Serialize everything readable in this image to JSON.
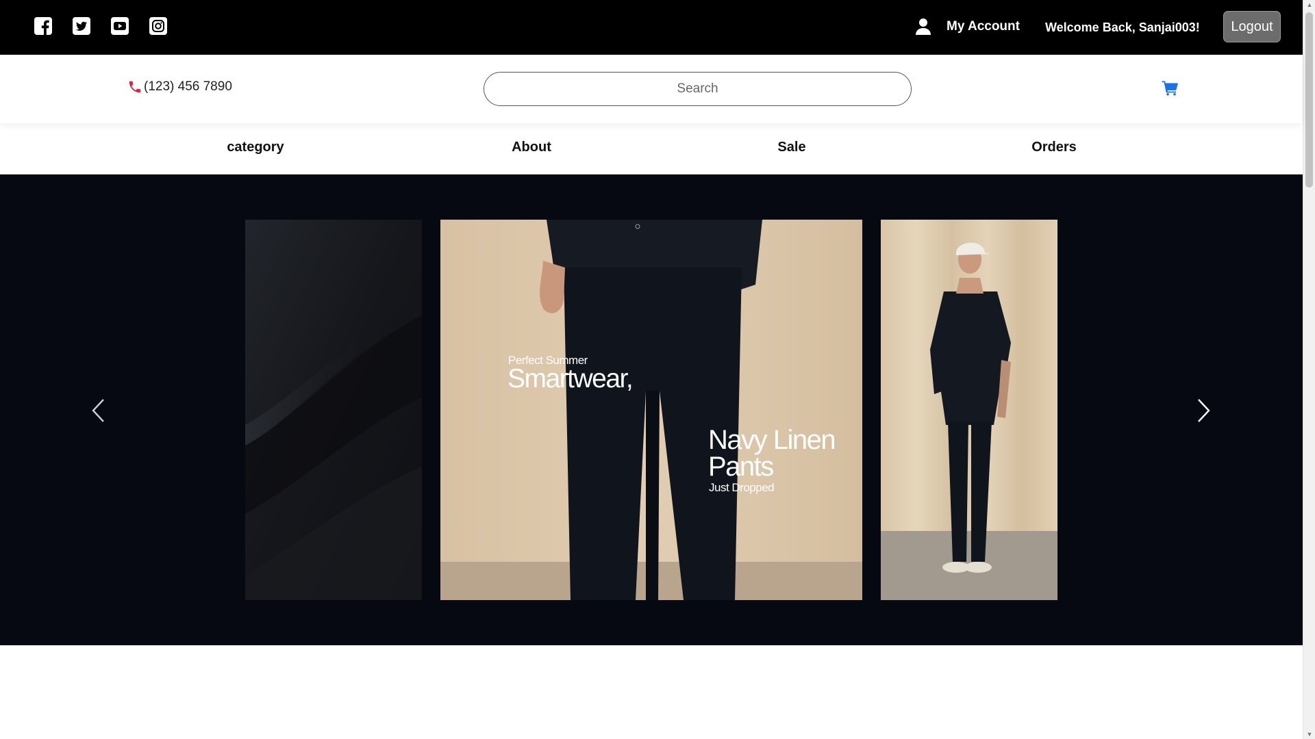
{
  "topbar": {
    "social": [
      {
        "icon": "facebook-icon"
      },
      {
        "icon": "twitter-icon"
      },
      {
        "icon": "youtube-icon"
      },
      {
        "icon": "instagram-icon"
      }
    ],
    "account_label": "My Account",
    "welcome_text": "Welcome Back, Sanjai003!",
    "logout_label": "Logout"
  },
  "header": {
    "phone": "(123) 456 7890",
    "search_placeholder": "Search",
    "search_value": "",
    "cart_icon": "cart-icon"
  },
  "nav": {
    "items": [
      {
        "label": "category"
      },
      {
        "label": "About"
      },
      {
        "label": "Sale"
      },
      {
        "label": "Orders"
      }
    ]
  },
  "hero": {
    "slide_text": {
      "line1": "Perfect Summer",
      "line2": "Smartwear,",
      "line3": "Navy Linen",
      "line4": "Pants",
      "line5": "Just Dropped"
    },
    "prev_icon": "chevron-left-icon",
    "next_icon": "chevron-right-icon"
  },
  "colors": {
    "topbar_bg": "#000000",
    "hero_bg": "#060912",
    "phone_icon": "#e0263a",
    "cart_icon": "#1a73e8",
    "logout_bg": "#6c6c6c"
  }
}
